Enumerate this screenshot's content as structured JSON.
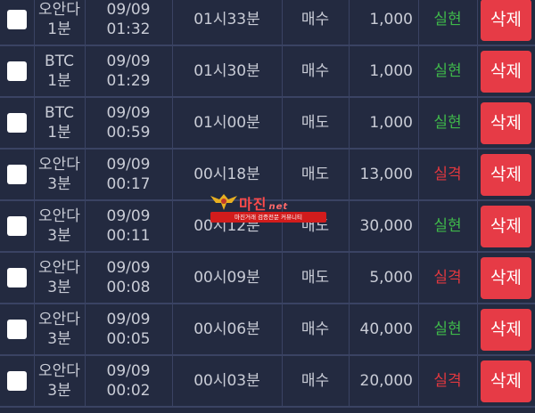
{
  "colors": {
    "background": "#232a40",
    "grid_line": "#3a4363",
    "result_hit": "#3fb84a",
    "result_miss": "#e0383f",
    "delete_button": "#e63b46"
  },
  "watermark": {
    "title": "마진",
    "title_suffix": "net",
    "subtitle": "마진거래 검증전문 커뮤니티"
  },
  "rows": [
    {
      "name_1": "오안다",
      "name_2": "1분",
      "date": "09/09",
      "time": "01:32",
      "order_time": "01시33분",
      "type": "매수",
      "amount": "1,000",
      "result": "실현",
      "result_kind": "hit",
      "delete_label": "삭제"
    },
    {
      "name_1": "BTC",
      "name_2": "1분",
      "date": "09/09",
      "time": "01:29",
      "order_time": "01시30분",
      "type": "매수",
      "amount": "1,000",
      "result": "실현",
      "result_kind": "hit",
      "delete_label": "삭제"
    },
    {
      "name_1": "BTC",
      "name_2": "1분",
      "date": "09/09",
      "time": "00:59",
      "order_time": "01시00분",
      "type": "매도",
      "amount": "1,000",
      "result": "실현",
      "result_kind": "hit",
      "delete_label": "삭제"
    },
    {
      "name_1": "오안다",
      "name_2": "3분",
      "date": "09/09",
      "time": "00:17",
      "order_time": "00시18분",
      "type": "매도",
      "amount": "13,000",
      "result": "실격",
      "result_kind": "miss",
      "delete_label": "삭제"
    },
    {
      "name_1": "오안다",
      "name_2": "3분",
      "date": "09/09",
      "time": "00:11",
      "order_time": "00시12분",
      "type": "매도",
      "amount": "30,000",
      "result": "실현",
      "result_kind": "hit",
      "delete_label": "삭제"
    },
    {
      "name_1": "오안다",
      "name_2": "3분",
      "date": "09/09",
      "time": "00:08",
      "order_time": "00시09분",
      "type": "매도",
      "amount": "5,000",
      "result": "실격",
      "result_kind": "miss",
      "delete_label": "삭제"
    },
    {
      "name_1": "오안다",
      "name_2": "3분",
      "date": "09/09",
      "time": "00:05",
      "order_time": "00시06분",
      "type": "매수",
      "amount": "40,000",
      "result": "실현",
      "result_kind": "hit",
      "delete_label": "삭제"
    },
    {
      "name_1": "오안다",
      "name_2": "3분",
      "date": "09/09",
      "time": "00:02",
      "order_time": "00시03분",
      "type": "매수",
      "amount": "20,000",
      "result": "실격",
      "result_kind": "miss",
      "delete_label": "삭제"
    }
  ]
}
